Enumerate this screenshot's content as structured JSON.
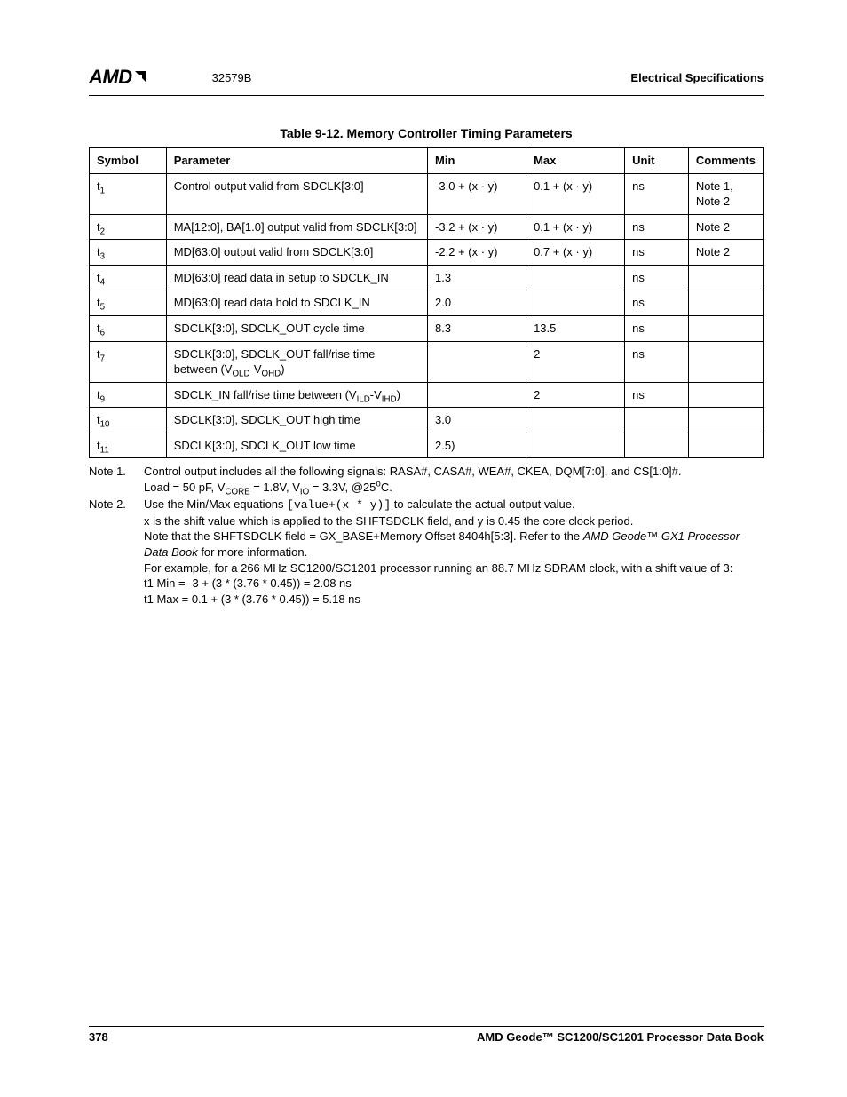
{
  "header": {
    "logo_text": "AMD",
    "doc_id": "32579B",
    "section": "Electrical Specifications"
  },
  "table": {
    "title": "Table 9-12.  Memory Controller Timing Parameters",
    "headers": {
      "symbol": "Symbol",
      "parameter": "Parameter",
      "min": "Min",
      "max": "Max",
      "unit": "Unit",
      "comments": "Comments"
    },
    "rows": [
      {
        "sym_base": "t",
        "sym_sub": "1",
        "param": "Control output valid from SDCLK[3:0]",
        "min": "-3.0 + (x · y)",
        "max": "0.1 + (x · y)",
        "unit": "ns",
        "comm": "Note 1, Note 2"
      },
      {
        "sym_base": "t",
        "sym_sub": "2",
        "param": "MA[12:0], BA[1.0] output valid from SDCLK[3:0]",
        "min": "-3.2 + (x · y)",
        "max": "0.1 + (x · y)",
        "unit": "ns",
        "comm": "Note 2"
      },
      {
        "sym_base": "t",
        "sym_sub": "3",
        "param": "MD[63:0] output valid from SDCLK[3:0]",
        "min": "-2.2 + (x · y)",
        "max": "0.7 + (x · y)",
        "unit": "ns",
        "comm": "Note 2"
      },
      {
        "sym_base": "t",
        "sym_sub": "4",
        "param": "MD[63:0] read data in setup to SDCLK_IN",
        "min": "1.3",
        "max": "",
        "unit": "ns",
        "comm": ""
      },
      {
        "sym_base": "t",
        "sym_sub": "5",
        "param": "MD[63:0] read data hold to SDCLK_IN",
        "min": "2.0",
        "max": "",
        "unit": "ns",
        "comm": ""
      },
      {
        "sym_base": "t",
        "sym_sub": "6",
        "param": "SDCLK[3:0], SDCLK_OUT cycle time",
        "min": "8.3",
        "max": "13.5",
        "unit": "ns",
        "comm": ""
      },
      {
        "sym_base": "t",
        "sym_sub": "7",
        "param_html": "SDCLK[3:0], SDCLK_OUT fall/rise time between (V<sub>OLD</sub>-V<sub>OHD</sub>)",
        "min": "",
        "max": "2",
        "unit": "ns",
        "comm": ""
      },
      {
        "sym_base": "t",
        "sym_sub": "9",
        "param_html": "SDCLK_IN fall/rise time between (V<sub>ILD</sub>-V<sub>IHD</sub>)",
        "min": "",
        "max": "2",
        "unit": "ns",
        "comm": ""
      },
      {
        "sym_base": "t",
        "sym_sub": "10",
        "param": "SDCLK[3:0], SDCLK_OUT high time",
        "min": "3.0",
        "max": "",
        "unit": "",
        "comm": ""
      },
      {
        "sym_base": "t",
        "sym_sub": "11",
        "param": "SDCLK[3:0], SDCLK_OUT low time",
        "min": "2.5)",
        "max": "",
        "unit": "",
        "comm": ""
      }
    ]
  },
  "notes": {
    "n1_label": "Note 1.",
    "n1_line1": "Control output includes all the following signals: RASA#, CASA#, WEA#, CKEA, DQM[7:0], and CS[1:0]#.",
    "n1_line2_html": "Load = 50 pF, V<sub>CORE</sub> = 1.8V, V<sub>IO</sub> = 3.3V, @25<sup>o</sup>C.",
    "n2_label": "Note 2.",
    "n2_line1_pre": "Use the Min/Max equations ",
    "n2_line1_code": "[value+(x * y)]",
    "n2_line1_post": " to calculate the actual output value.",
    "n2_line2": "x is the shift value which is applied to the SHFTSDCLK field, and y is 0.45 the core clock period.",
    "n2_line3_pre": "Note that the SHFTSDCLK field = GX_BASE+Memory Offset 8404h[5:3]. Refer to the ",
    "n2_line3_italic": "AMD Geode™ GX1 Processor Data Book",
    "n2_line3_post": " for more information.",
    "n2_line4": "For example, for a 266 MHz SC1200/SC1201 processor running an 88.7 MHz SDRAM clock, with a shift value of 3:",
    "n2_line5": "t1 Min = -3 + (3 * (3.76 * 0.45)) = 2.08 ns",
    "n2_line6": "t1 Max = 0.1 + (3 * (3.76 * 0.45)) = 5.18 ns"
  },
  "footer": {
    "page": "378",
    "book": "AMD Geode™ SC1200/SC1201 Processor Data Book"
  }
}
